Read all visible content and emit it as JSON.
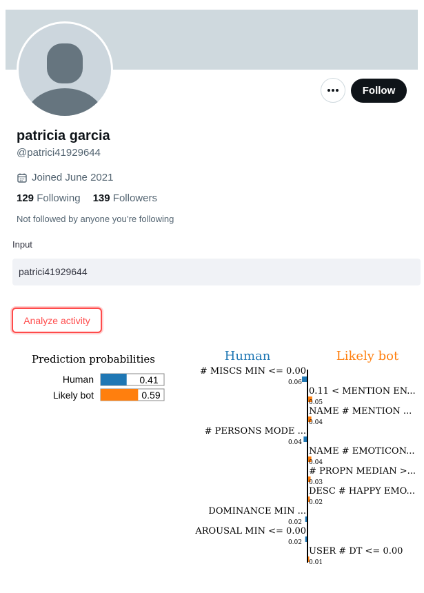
{
  "profile": {
    "name": "patricia garcia",
    "handle": "@patrici41929644",
    "joined": "Joined June 2021",
    "following_count": "129",
    "following_label": "Following",
    "followers_count": "139",
    "followers_label": "Followers",
    "not_followed": "Not followed by anyone you’re following",
    "follow_label": "Follow",
    "more_icon": "more-horizontal-icon",
    "calendar_icon": "calendar-icon"
  },
  "form": {
    "input_label": "Input",
    "input_value": "patrici41929644",
    "analyze_label": "Analyze activity"
  },
  "prediction": {
    "title": "Prediction probabilities",
    "rows": [
      {
        "label": "Human",
        "value": 0.41,
        "display": "0.41",
        "color": "#1f77b4"
      },
      {
        "label": "Likely bot",
        "value": 0.59,
        "display": "0.59",
        "color": "#ff7f0e"
      }
    ]
  },
  "explanation": {
    "left_header": "Human",
    "right_header": "Likely bot",
    "colors": {
      "human": "#1f77b4",
      "bot": "#ff7f0e"
    },
    "features": [
      {
        "label": "# MISCS MIN <= 0.00",
        "value": "0.06",
        "weight": 0.06,
        "side": "human"
      },
      {
        "label": "0.11 < MENTION EN...",
        "value": "0.05",
        "weight": 0.05,
        "side": "bot"
      },
      {
        "label": "NAME # MENTION ...",
        "value": "0.04",
        "weight": 0.04,
        "side": "bot"
      },
      {
        "label": "# PERSONS MODE ...",
        "value": "0.04",
        "weight": 0.04,
        "side": "human"
      },
      {
        "label": "NAME # EMOTICON...",
        "value": "0.04",
        "weight": 0.04,
        "side": "bot"
      },
      {
        "label": "# PROPN MEDIAN >...",
        "value": "0.03",
        "weight": 0.03,
        "side": "bot"
      },
      {
        "label": "DESC # HAPPY EMO...",
        "value": "0.02",
        "weight": 0.02,
        "side": "bot"
      },
      {
        "label": "DOMINANCE MIN ...",
        "value": "0.02",
        "weight": 0.02,
        "side": "human"
      },
      {
        "label": "AROUSAL MIN <= 0.00",
        "value": "0.02",
        "weight": 0.02,
        "side": "human"
      },
      {
        "label": "USER # DT <= 0.00",
        "value": "0.01",
        "weight": 0.01,
        "side": "bot"
      }
    ]
  }
}
